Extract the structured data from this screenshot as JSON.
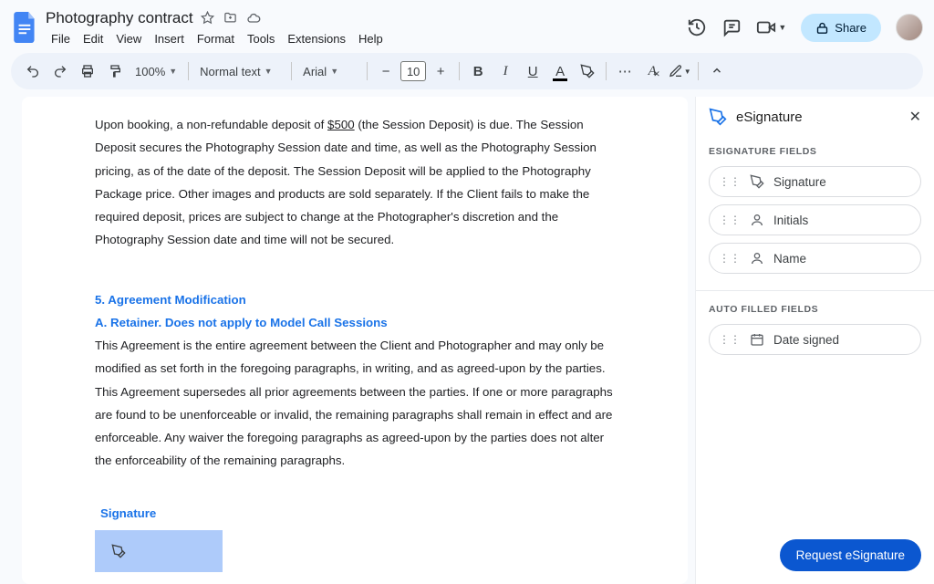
{
  "header": {
    "doc_title": "Photography contract",
    "menus": [
      "File",
      "Edit",
      "View",
      "Insert",
      "Format",
      "Tools",
      "Extensions",
      "Help"
    ],
    "share_label": "Share"
  },
  "toolbar": {
    "zoom": "100%",
    "style": "Normal text",
    "font": "Arial",
    "font_size": "10"
  },
  "doc": {
    "p1": "Upon booking, a non-refundable deposit of ",
    "deposit": "$500",
    "p1b": " (the Session Deposit) is due. The Session Deposit secures the Photography Session date and time, as well as the Photography Session pricing, as of the date of the deposit. The Session Deposit will be applied to the Photography Package price. Other images and products are sold separately. If the Client fails to make the required deposit, prices are subject to change at the Photographer's discretion and the Photography Session date and time will not be secured.",
    "h1": "5. Agreement Modification",
    "h2": "A. Retainer.  Does not apply to Model Call Sessions",
    "p2": "This Agreement is the entire agreement between the Client and Photographer and may only be modified as set forth in the foregoing paragraphs, in writing, and as agreed-upon by the parties.  This Agreement supersedes all prior agreements between the parties. If one or more paragraphs are found to be unenforceable or invalid, the remaining paragraphs shall remain in effect and are enforceable. Any waiver the foregoing paragraphs as agreed-upon by the parties does not alter the enforceability of the remaining paragraphs.",
    "sig_label": "Signature"
  },
  "sidepanel": {
    "title": "eSignature",
    "section1": "ESIGNATURE FIELDS",
    "fields": [
      "Signature",
      "Initials",
      "Name"
    ],
    "section2": "AUTO FILLED FIELDS",
    "auto_fields": [
      "Date signed"
    ],
    "cta": "Request eSignature"
  }
}
